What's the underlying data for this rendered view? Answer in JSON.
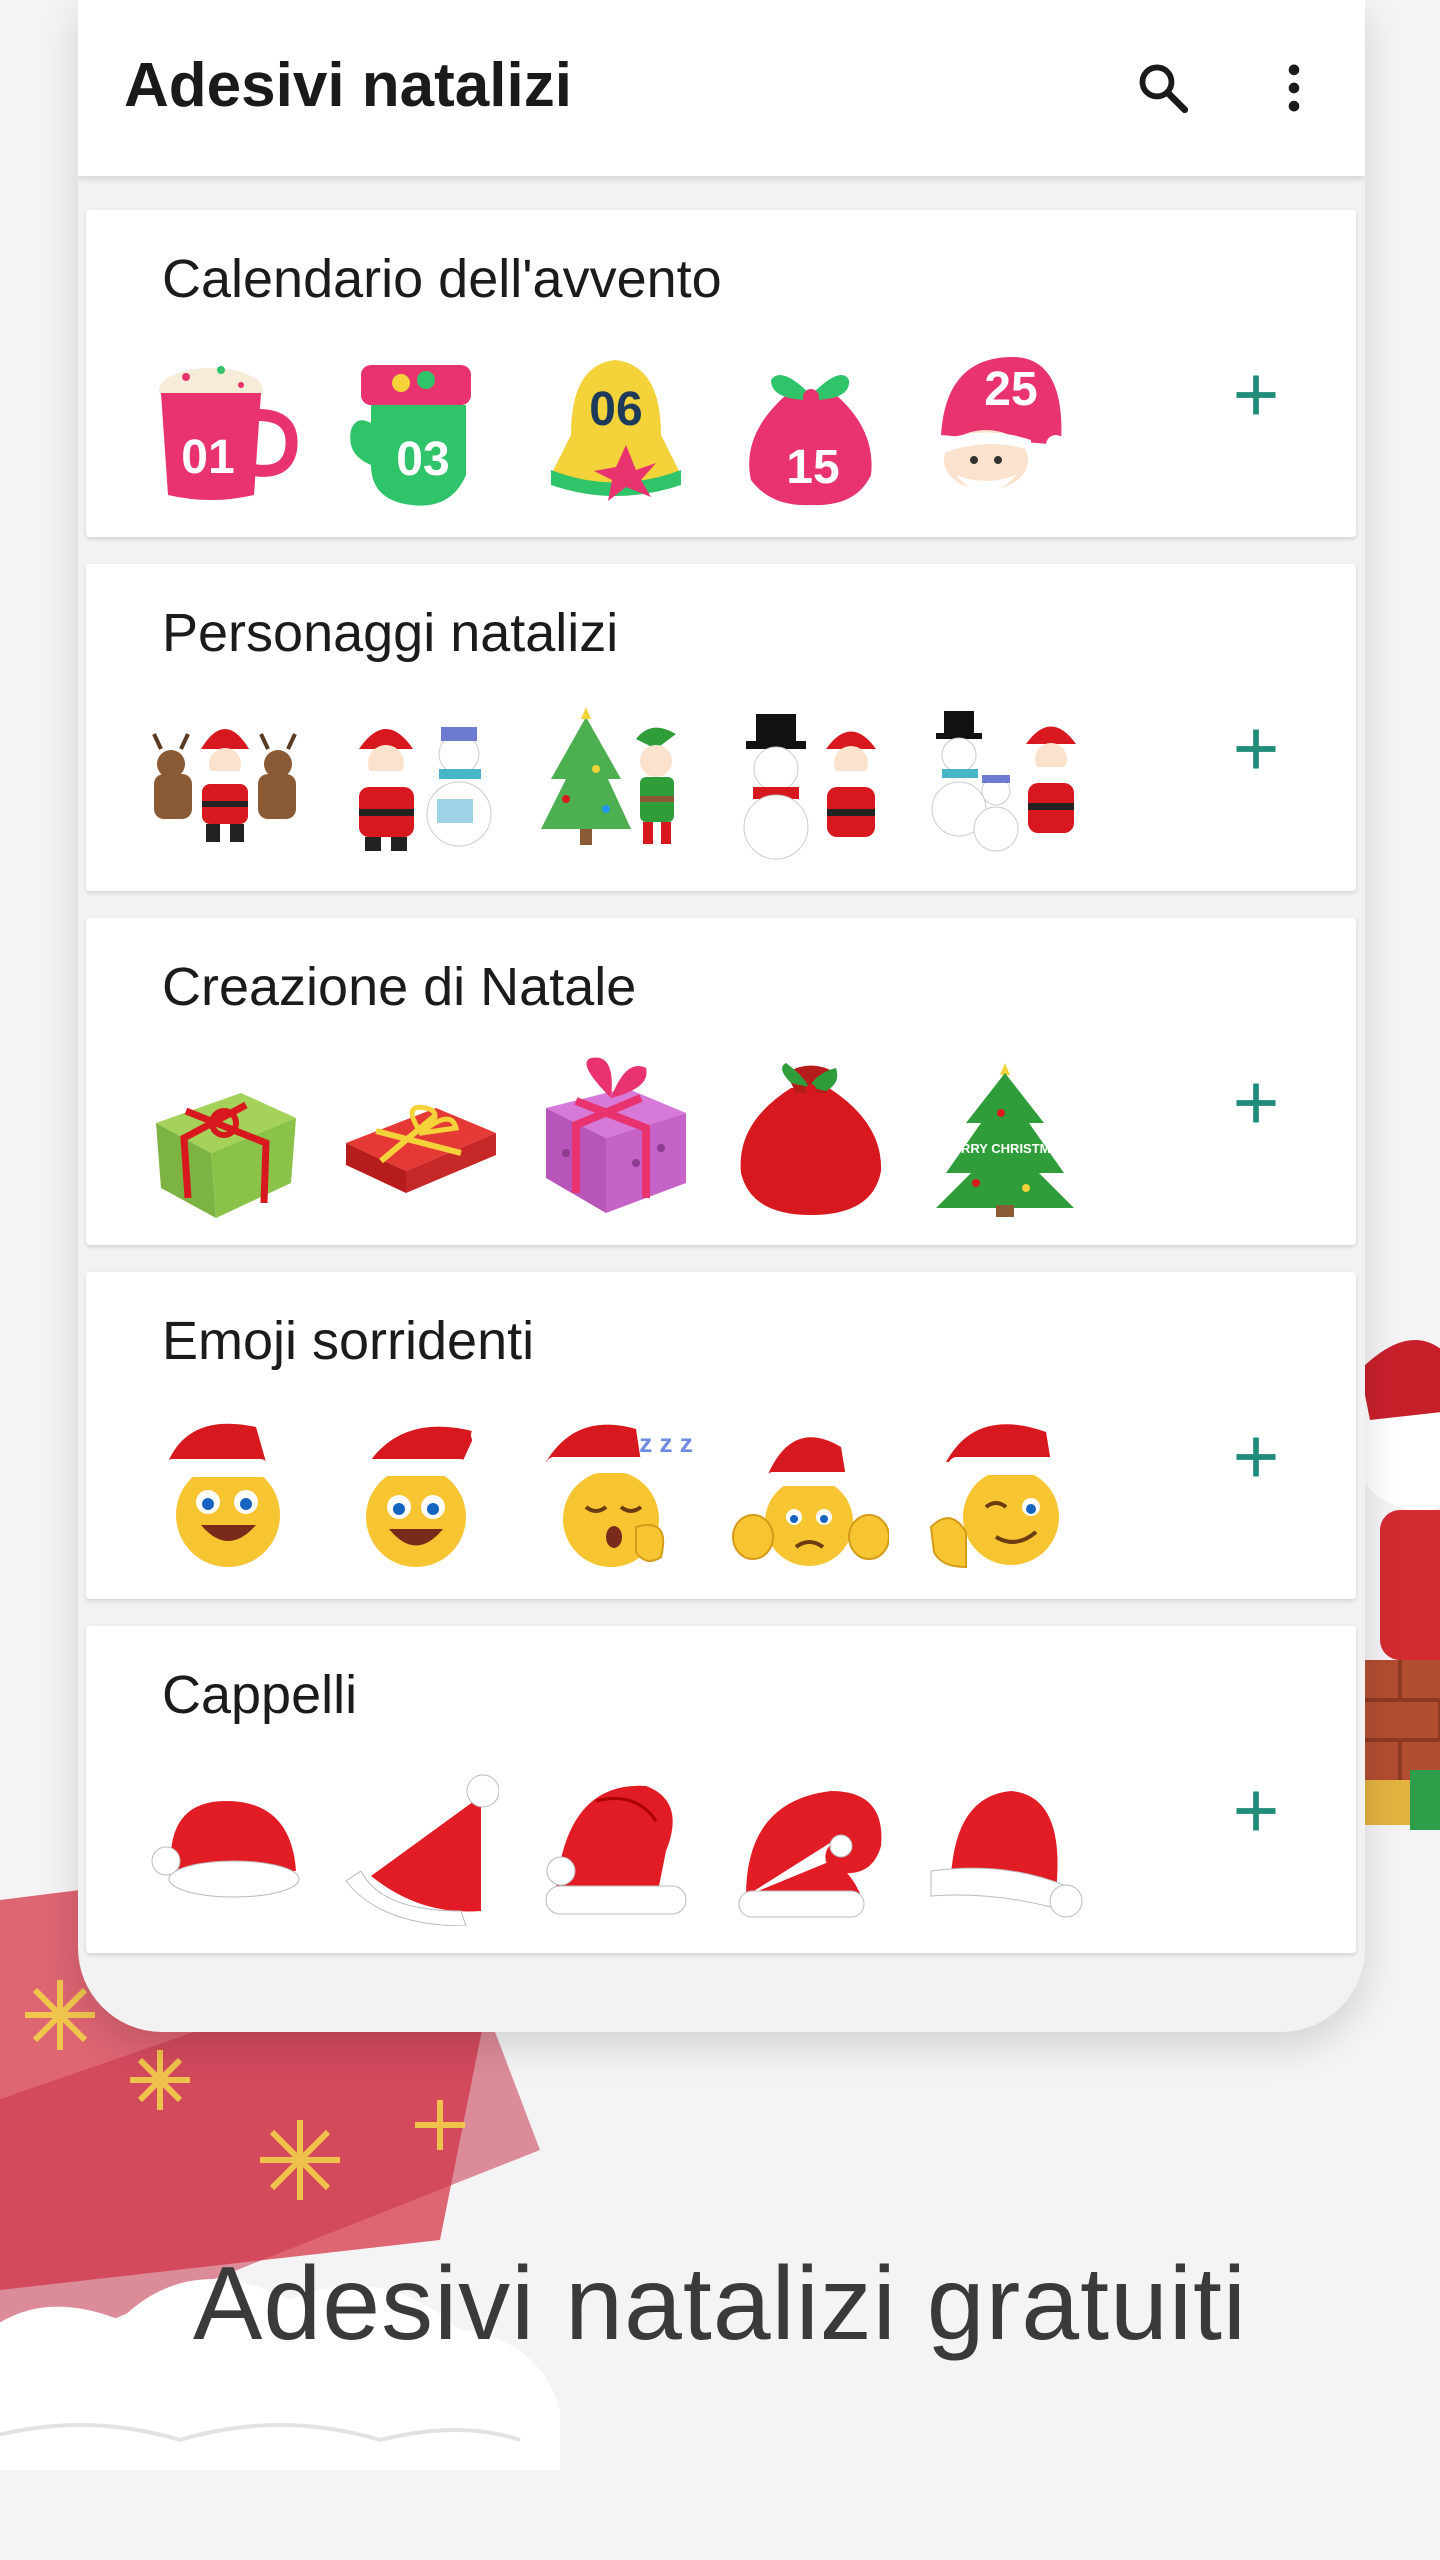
{
  "app": {
    "title": "Adesivi natalizi",
    "search_icon": "search-icon",
    "more_icon": "more-vertical-icon"
  },
  "packs": [
    {
      "title": "Calendario dell'avvento",
      "stickers": [
        "mug-01-sticker",
        "mitten-03-sticker",
        "bell-06-sticker",
        "sack-15-sticker",
        "santa-hat-25-sticker"
      ],
      "numbers": [
        "01",
        "03",
        "06",
        "15",
        "25"
      ]
    },
    {
      "title": "Personaggi natalizi",
      "stickers": [
        "santa-reindeer-sticker",
        "santa-snowman-sticker",
        "tree-elf-sticker",
        "snowman-santa-sticker",
        "snowmen-santa-sticker"
      ]
    },
    {
      "title": "Creazione di Natale",
      "stickers": [
        "green-gift-sticker",
        "red-gift-sticker",
        "purple-gift-sticker",
        "red-sack-sticker",
        "christmas-tree-sticker"
      ],
      "tree_text": "MERRY CHRISTMAS"
    },
    {
      "title": "Emoji sorridenti",
      "stickers": [
        "laughing-emoji-sticker",
        "grinning-emoji-sticker",
        "sleepy-emoji-sticker",
        "worried-emoji-sticker",
        "winking-emoji-sticker"
      ],
      "sleep_text": "z z z"
    },
    {
      "title": "Cappelli",
      "stickers": [
        "santa-hat-1-sticker",
        "santa-hat-2-sticker",
        "santa-hat-3-sticker",
        "santa-hat-4-sticker",
        "santa-hat-5-sticker"
      ]
    }
  ],
  "add_icon": "plus-icon",
  "promo": {
    "caption": "Adesivi natalizi gratuiti"
  },
  "colors": {
    "accent": "#1f8b7a",
    "pink": "#e8336e",
    "green": "#2fc46a",
    "yellow": "#f3d23a",
    "santa_red": "#d7191f"
  }
}
